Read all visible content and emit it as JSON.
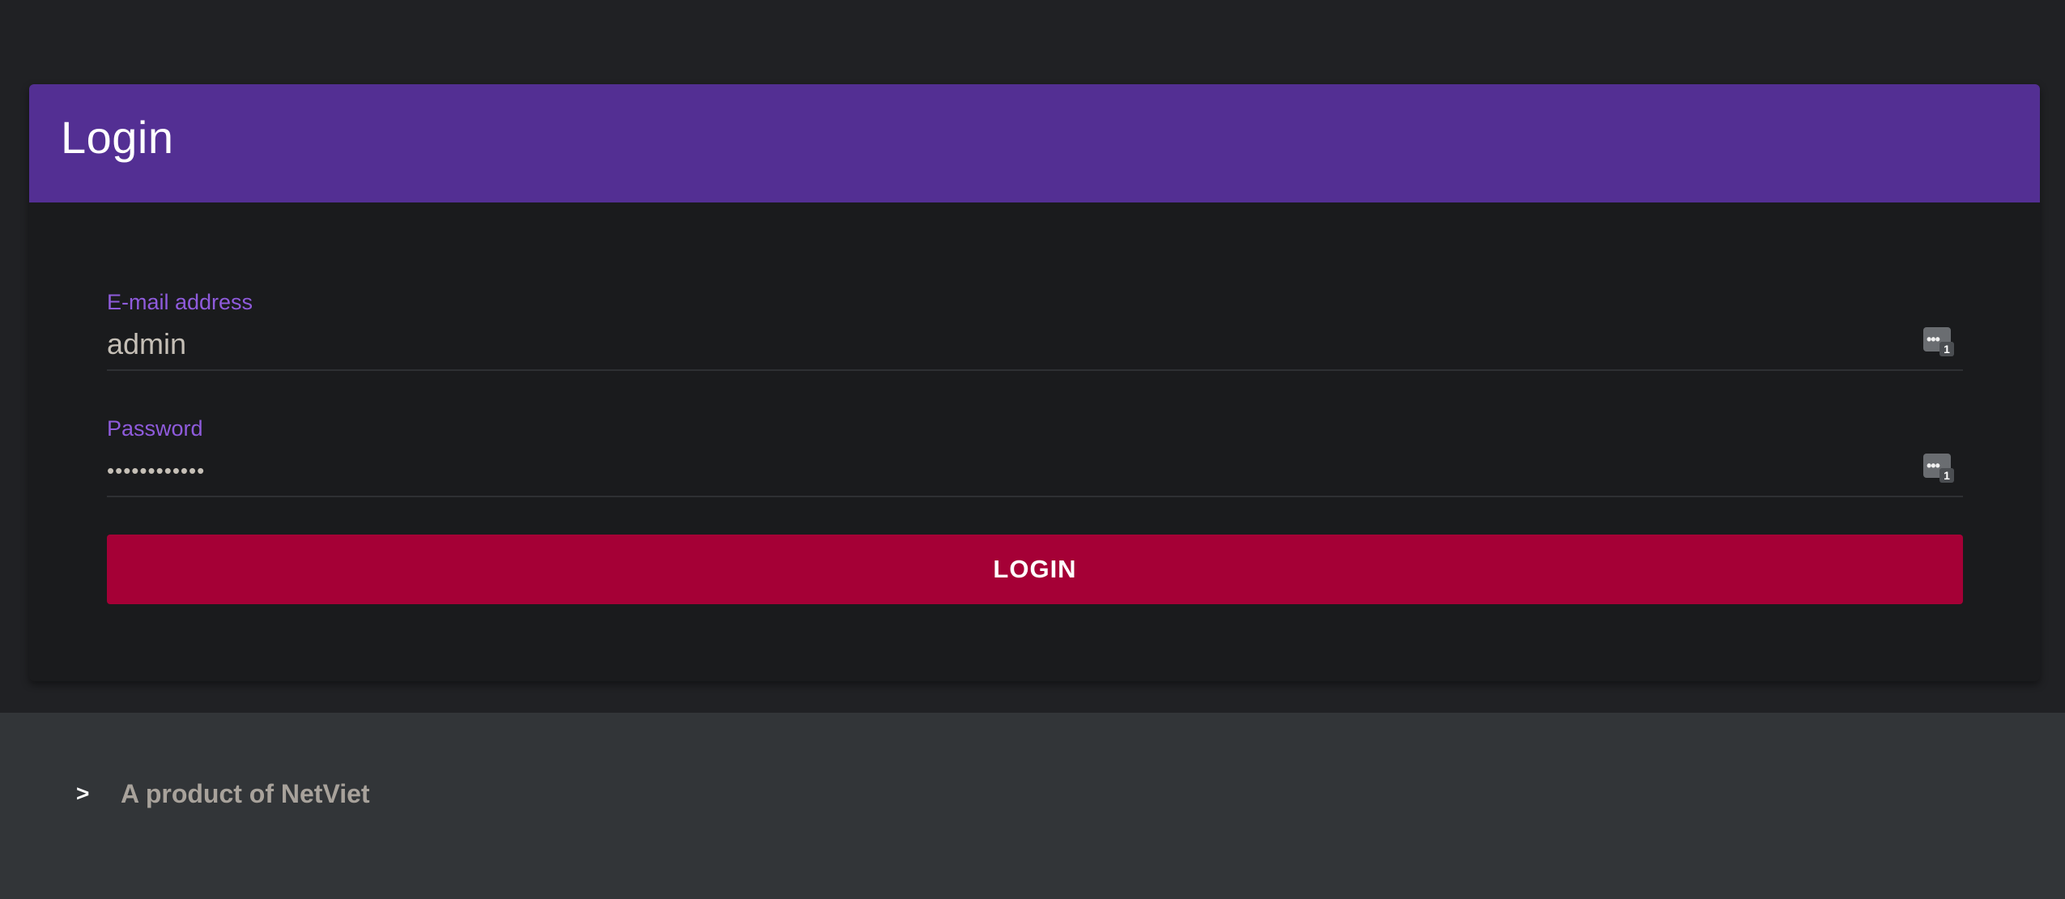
{
  "login_card": {
    "title": "Login",
    "header_color": "#532f93",
    "email": {
      "label": "E-mail address",
      "value": "admin",
      "icon": "password-manager-icon",
      "icon_badge": "1"
    },
    "password": {
      "label": "Password",
      "masked_value": "••••••••••••",
      "icon": "password-manager-icon",
      "icon_badge": "1"
    },
    "submit_label": "LOGIN",
    "submit_color": "#a50036"
  },
  "footer": {
    "chevron": ">",
    "text": "A product of NetViet"
  }
}
